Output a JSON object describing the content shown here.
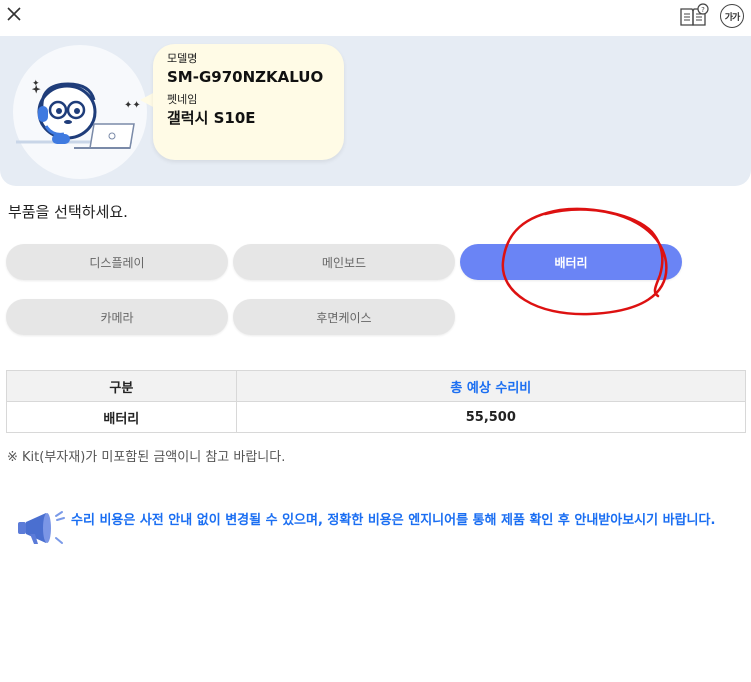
{
  "topbar": {
    "font_size_label": "가가"
  },
  "device": {
    "model_label": "모델명",
    "model_value": "SM-G970NZKALUO",
    "petname_label": "펫네임",
    "petname_value": "갤럭시 S10E"
  },
  "parts": {
    "title": "부품을 선택하세요.",
    "items": [
      {
        "label": "디스플레이",
        "selected": false
      },
      {
        "label": "메인보드",
        "selected": false
      },
      {
        "label": "배터리",
        "selected": true
      },
      {
        "label": "카메라",
        "selected": false
      },
      {
        "label": "후면케이스",
        "selected": false
      }
    ]
  },
  "cost_table": {
    "headers": [
      "구분",
      "총 예상 수리비"
    ],
    "rows": [
      [
        "배터리",
        "55,500"
      ]
    ]
  },
  "note": "※ Kit(부자재)가 미포함된 금액이니 참고 바랍니다.",
  "notice": "수리 비용은 사전 안내 없이 변경될 수 있으며, 정확한 비용은 엔지니어를 통해 제품 확인 후 안내받아보시기 바랍니다.",
  "colors": {
    "accent": "#6a84f5",
    "link_blue": "#1a6ef2",
    "hero_bg": "#e6ecf4",
    "bubble_bg": "#fffbe6",
    "annotation_red": "#dd1111"
  },
  "icons": [
    "close-icon",
    "manual-book-icon",
    "font-size-icon",
    "mascot-illustration",
    "megaphone-icon"
  ]
}
